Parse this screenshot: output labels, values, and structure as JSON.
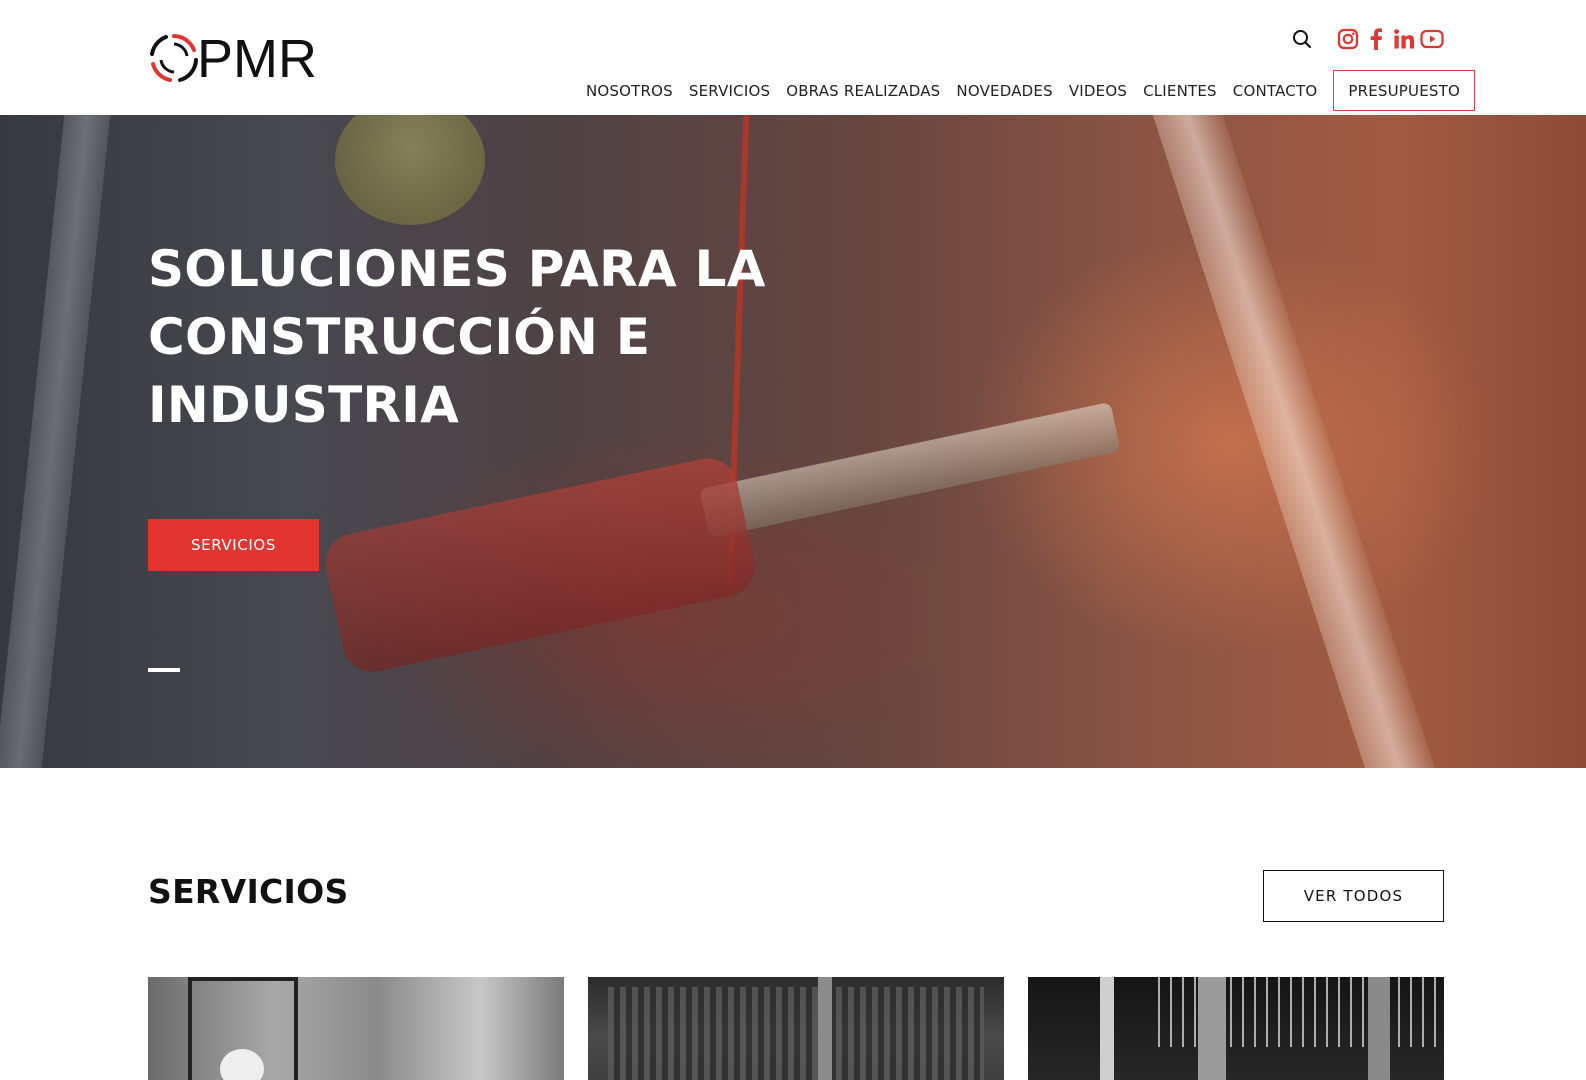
{
  "brand": {
    "logo_text": "PMR",
    "accent_color": "#e3352f",
    "loader_color": "#1e6bd6"
  },
  "loader": {
    "progress": 0.2
  },
  "header": {
    "icons": [
      "search-icon",
      "instagram-icon",
      "facebook-icon",
      "linkedin-icon",
      "youtube-icon"
    ],
    "nav": {
      "items": [
        {
          "label": "NOSOTROS"
        },
        {
          "label": "SERVICIOS"
        },
        {
          "label": "OBRAS REALIZADAS"
        },
        {
          "label": "NOVEDADES"
        },
        {
          "label": "VIDEOS"
        },
        {
          "label": "CLIENTES"
        },
        {
          "label": "CONTACTO"
        }
      ],
      "cta_label": "PRESUPUESTO"
    }
  },
  "hero": {
    "title": "SOLUCIONES PARA LA CONSTRUCCIÓN E INDUSTRIA",
    "button_label": "SERVICIOS"
  },
  "services": {
    "title": "SERVICIOS",
    "see_all_label": "VER TODOS"
  }
}
